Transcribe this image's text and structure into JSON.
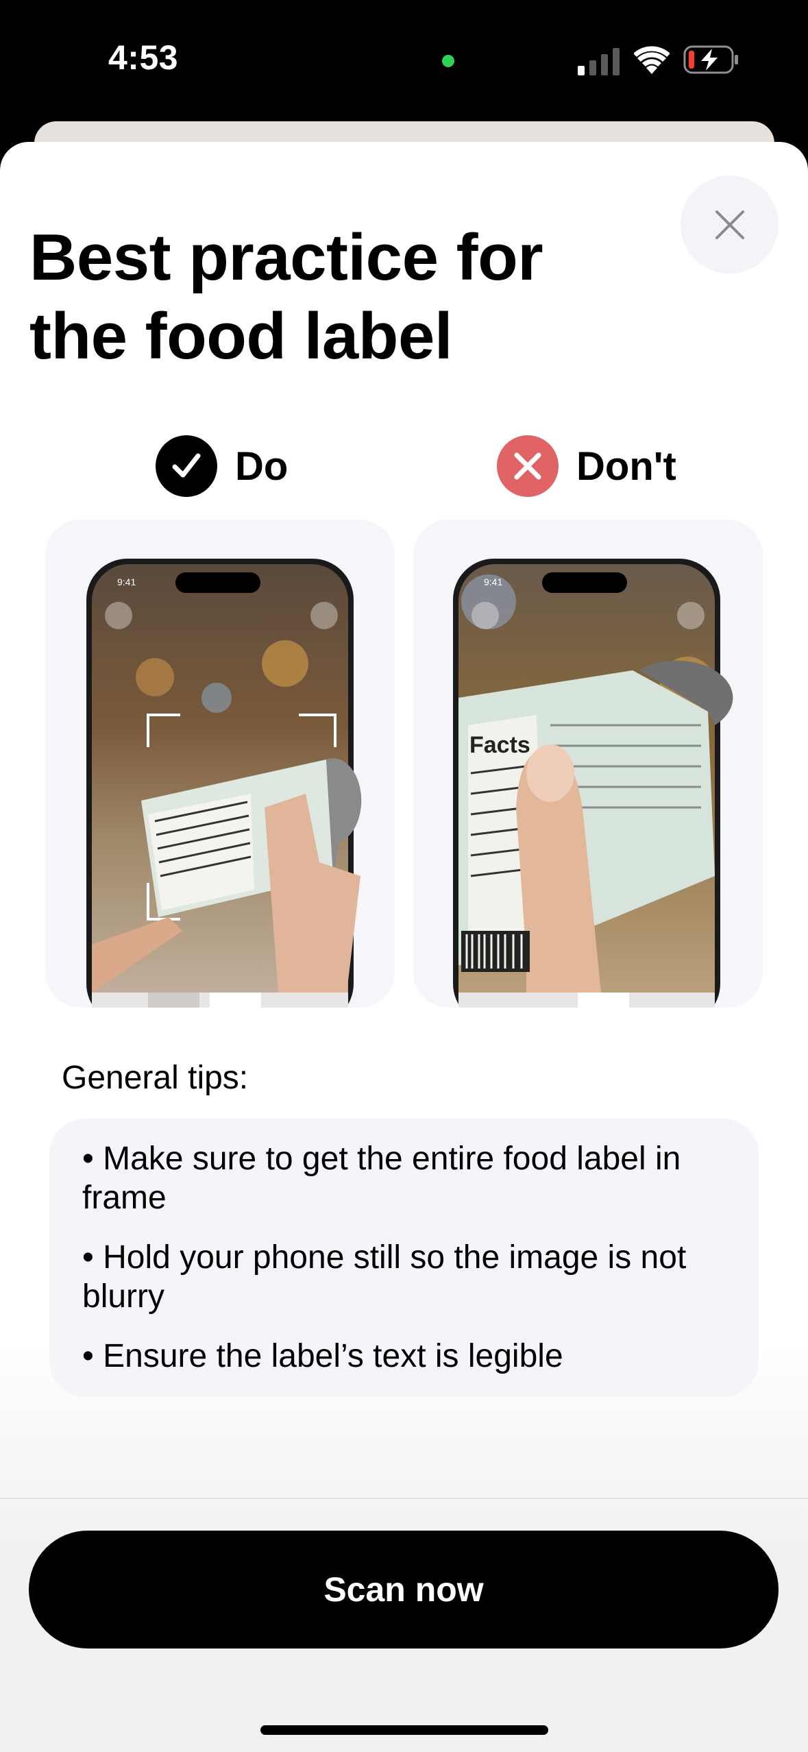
{
  "status_bar": {
    "time": "4:53",
    "icons": [
      "camera-indicator-dot",
      "cellular-signal-icon",
      "wifi-icon",
      "battery-charging-icon"
    ]
  },
  "sheet": {
    "title": "Best practice for the food label",
    "close_icon": "close-icon"
  },
  "examples": {
    "do": {
      "label": "Do",
      "icon": "checkmark-icon",
      "badge_color": "#000000"
    },
    "dont": {
      "label": "Don't",
      "icon": "x-icon",
      "badge_color": "#e06366"
    }
  },
  "tips": {
    "heading": "General tips:",
    "items": [
      "• Make sure to get the entire food label in frame",
      "• Hold your phone still so the image is not blurry",
      "• Ensure the label’s text is legible"
    ]
  },
  "actions": {
    "scan_label": "Scan now"
  },
  "colors": {
    "accent": "#000000",
    "dont_red": "#e06366",
    "card_bg": "#f6f5fa"
  }
}
